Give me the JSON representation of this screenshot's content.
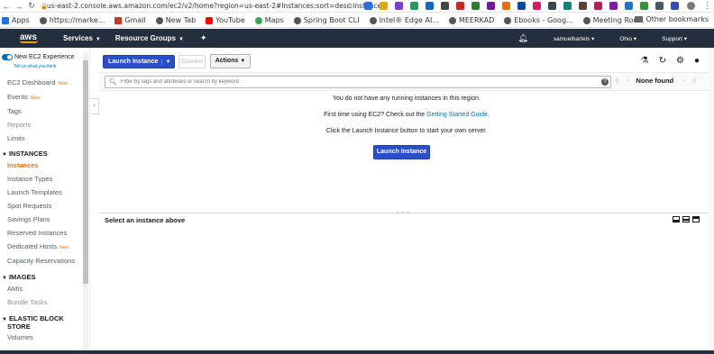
{
  "browser": {
    "url": "us-east-2.console.aws.amazon.com/ec2/v2/home?region=us-east-2#Instances:sort=desc:instance...",
    "bookmarks": [
      {
        "label": "Apps",
        "color": "#1a73e8"
      },
      {
        "label": "https://marke...",
        "color": "#555555"
      },
      {
        "label": "Gmail",
        "color": "#d93025"
      },
      {
        "label": "New Tab",
        "color": "#555555"
      },
      {
        "label": "YouTube",
        "color": "#ff0000"
      },
      {
        "label": "Maps",
        "color": "#34a853"
      },
      {
        "label": "Spring Boot CLI",
        "color": "#555555"
      },
      {
        "label": "Intel® Edge AI...",
        "color": "#555555"
      },
      {
        "label": "MEERKAD",
        "color": "#555555"
      },
      {
        "label": "Ebooks - Goog...",
        "color": "#555555"
      },
      {
        "label": "Meeting Roo...",
        "color": "#555555"
      }
    ],
    "other_bookmarks": "Other bookmarks"
  },
  "aws": {
    "logo": "aws",
    "services": "Services",
    "resource_groups": "Resource Groups",
    "user": "samuelbartels",
    "region": "Ohio",
    "support": "Support"
  },
  "sidebar": {
    "new_experience": "New EC2 Experience",
    "tell_us": "Tell us what you think",
    "top_items": [
      {
        "label": "EC2 Dashboard",
        "badge": "New"
      },
      {
        "label": "Events",
        "badge": "New"
      },
      {
        "label": "Tags",
        "badge": ""
      },
      {
        "label": "Reports",
        "badge": ""
      },
      {
        "label": "Limits",
        "badge": ""
      }
    ],
    "instances_header": "INSTANCES",
    "instances_items": [
      {
        "label": "Instances",
        "badge": ""
      },
      {
        "label": "Instance Types",
        "badge": ""
      },
      {
        "label": "Launch Templates",
        "badge": ""
      },
      {
        "label": "Spot Requests",
        "badge": ""
      },
      {
        "label": "Savings Plans",
        "badge": ""
      },
      {
        "label": "Reserved Instances",
        "badge": ""
      },
      {
        "label": "Dedicated Hosts",
        "badge": "New"
      },
      {
        "label": "Capacity Reservations",
        "badge": ""
      }
    ],
    "images_header": "IMAGES",
    "images_items": [
      {
        "label": "AMIs",
        "badge": ""
      },
      {
        "label": "Bundle Tasks",
        "badge": ""
      }
    ],
    "ebs_header_1": "ELASTIC BLOCK",
    "ebs_header_2": "STORE",
    "ebs_items": [
      {
        "label": "Volumes",
        "badge": ""
      }
    ]
  },
  "toolbar": {
    "launch_instance": "Launch Instance",
    "connect": "Connect",
    "actions": "Actions"
  },
  "search": {
    "placeholder": "Filter by tags and attributes or search by keyword",
    "none_found": "None found"
  },
  "empty_state": {
    "line1": "You do not have any running instances in this region.",
    "line2_prefix": "First time using EC2? Check out the ",
    "line2_link": "Getting Started Guide",
    "line2_suffix": ".",
    "line3": "Click the Launch Instance button to start your own server.",
    "button": "Launch Instance"
  },
  "details": {
    "title": "Select an instance above"
  }
}
